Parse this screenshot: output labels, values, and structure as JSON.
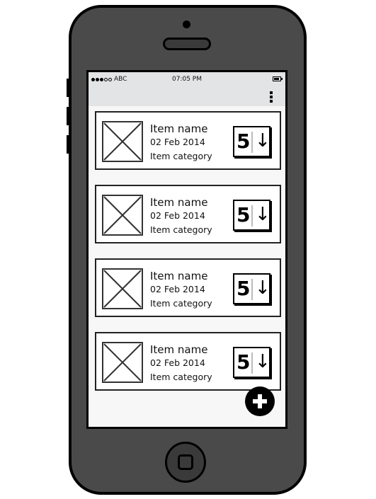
{
  "status_bar": {
    "carrier": "ABC",
    "time": "07:05 PM",
    "signal_icon": "signal-dots-icon",
    "battery_icon": "battery-icon"
  },
  "app_bar": {
    "menu_icon": "kebab-menu-icon"
  },
  "items": [
    {
      "name": "Item name",
      "date": "02 Feb 2014",
      "category": "Item category",
      "sort_number": "5",
      "sort_arrow": "↓"
    },
    {
      "name": "Item name",
      "date": "02 Feb 2014",
      "category": "Item category",
      "sort_number": "5",
      "sort_arrow": "↓"
    },
    {
      "name": "Item name",
      "date": "02 Feb 2014",
      "category": "Item category",
      "sort_number": "5",
      "sort_arrow": "↓"
    },
    {
      "name": "Item name",
      "date": "02 Feb 2014",
      "category": "Item category",
      "sort_number": "5",
      "sort_arrow": "↓"
    }
  ],
  "fab": {
    "icon": "plus-icon"
  },
  "colors": {
    "phone_body": "#4a4a4a",
    "screen_bg": "#f7f7f7",
    "bar_bg": "#e3e4e5",
    "outline": "#000000"
  }
}
